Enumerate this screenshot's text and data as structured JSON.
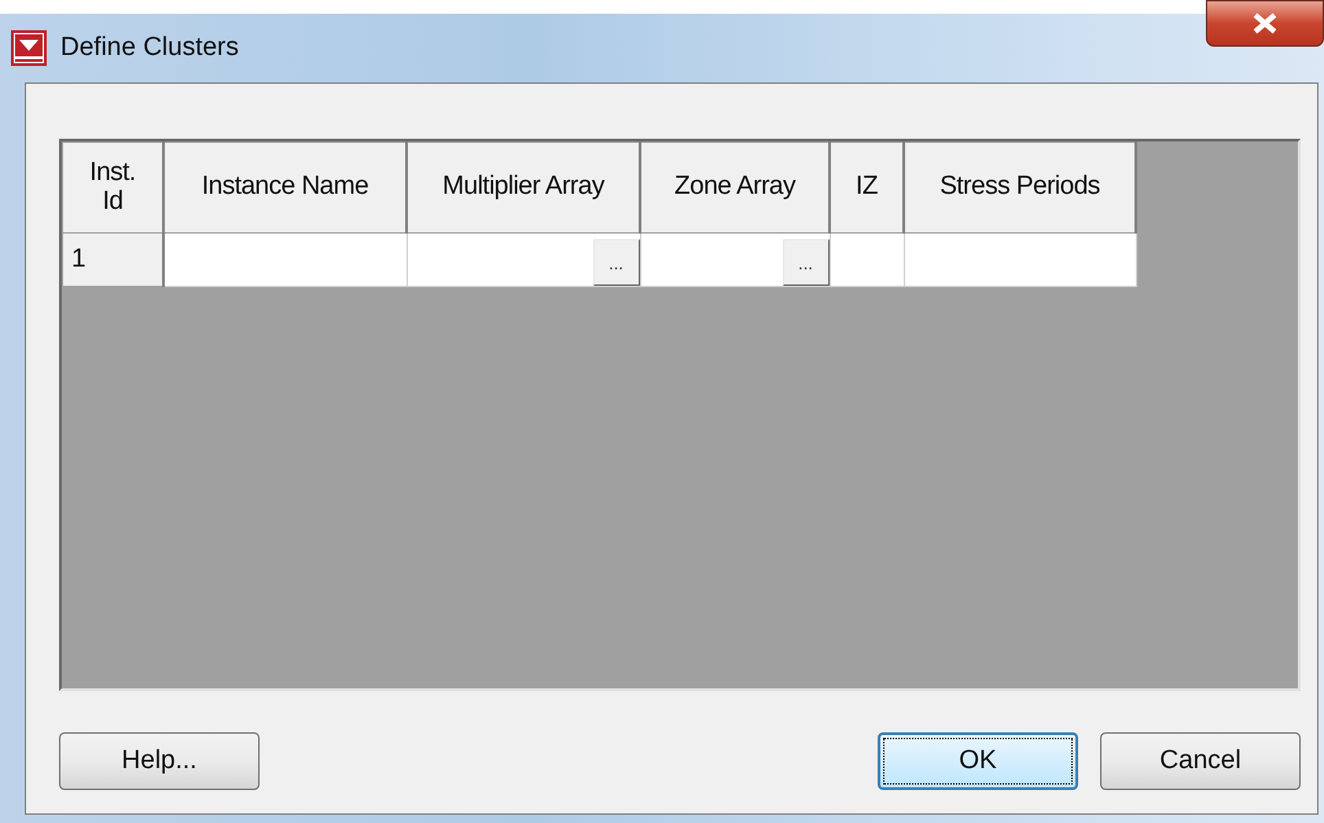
{
  "window": {
    "title": "Define Clusters"
  },
  "table": {
    "columns": [
      {
        "label": "Inst.\nId",
        "kind": "id"
      },
      {
        "label": "Instance Name",
        "kind": "text"
      },
      {
        "label": "Multiplier Array",
        "kind": "picker"
      },
      {
        "label": "Zone Array",
        "kind": "picker"
      },
      {
        "label": "IZ",
        "kind": "text"
      },
      {
        "label": "Stress Periods",
        "kind": "text"
      }
    ],
    "rows": [
      {
        "id": "1",
        "picker_label": "..."
      }
    ]
  },
  "buttons": [
    {
      "label": "Help...",
      "default": false
    },
    {
      "label": "OK",
      "default": true
    },
    {
      "label": "Cancel",
      "default": false
    }
  ]
}
